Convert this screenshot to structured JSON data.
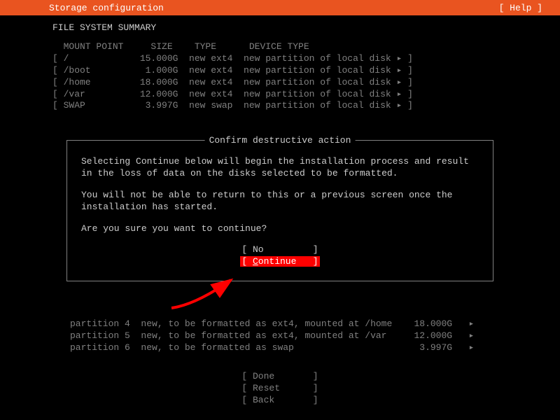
{
  "header": {
    "title": "Storage configuration",
    "help": "[ Help ]"
  },
  "fs_summary": {
    "title": "FILE SYSTEM SUMMARY",
    "header": "  MOUNT POINT     SIZE    TYPE      DEVICE TYPE",
    "rows": [
      "[ /             15.000G  new ext4  new partition of local disk ▸ ]",
      "[ /boot          1.000G  new ext4  new partition of local disk ▸ ]",
      "[ /home         18.000G  new ext4  new partition of local disk ▸ ]",
      "[ /var          12.000G  new ext4  new partition of local disk ▸ ]",
      "[ SWAP           3.997G  new swap  new partition of local disk ▸ ]"
    ]
  },
  "dialog": {
    "title": "Confirm destructive action",
    "para1": "Selecting Continue below will begin the installation process and result in the loss of data on the disks selected to be formatted.",
    "para2": "You will not be able to return to this or a previous screen once the installation has started.",
    "para3": "Are you sure you want to continue?",
    "no_label": "[ No         ]",
    "continue_prefix": "[ ",
    "continue_c": "C",
    "continue_rest": "ontinue   ]"
  },
  "partitions": {
    "rows": [
      "partition 4  new, to be formatted as ext4, mounted at /home    18.000G   ▸",
      "partition 5  new, to be formatted as ext4, mounted at /var     12.000G   ▸",
      "partition 6  new, to be formatted as swap                       3.997G   ▸"
    ]
  },
  "bottom": {
    "done": "[ Done       ]",
    "reset": "[ Reset      ]",
    "back": "[ Back       ]"
  }
}
